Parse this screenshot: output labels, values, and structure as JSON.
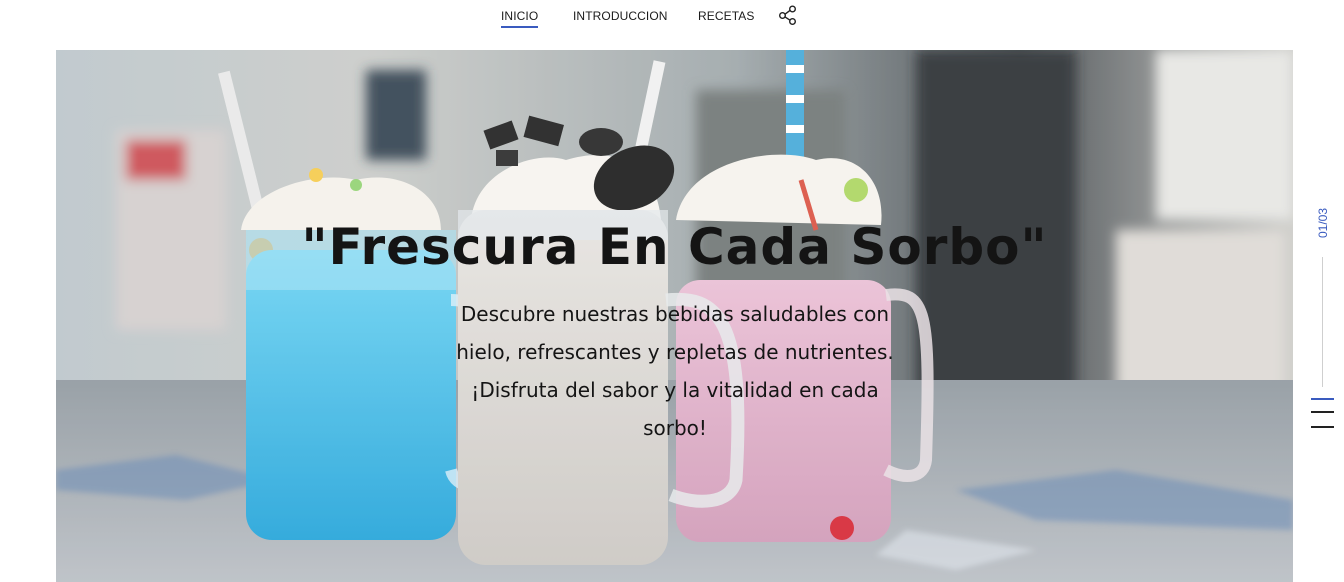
{
  "nav": {
    "items": [
      {
        "label": "INICIO",
        "active": true
      },
      {
        "label": "INTRODUCCION",
        "active": false
      },
      {
        "label": "RECETAS",
        "active": false
      }
    ],
    "share_icon": "share-icon"
  },
  "hero": {
    "headline": "\"Frescura En Cada Sorbo\"",
    "lead": "Descubre nuestras bebidas saludables con hielo, refrescantes y repletas de nutrientes. ¡Disfruta del sabor y la vitalidad en cada sorbo!",
    "image_subject": "three milkshake jars: blue, vanilla with cookies, pink"
  },
  "slider": {
    "counter": "01/03",
    "current": 1,
    "total": 3
  },
  "colors": {
    "accent": "#3a5bbf",
    "text": "#151515",
    "blue_shake": "#2bb2e6",
    "vanilla_shake": "#d6d2cd",
    "pink_shake": "#dba7c3"
  }
}
